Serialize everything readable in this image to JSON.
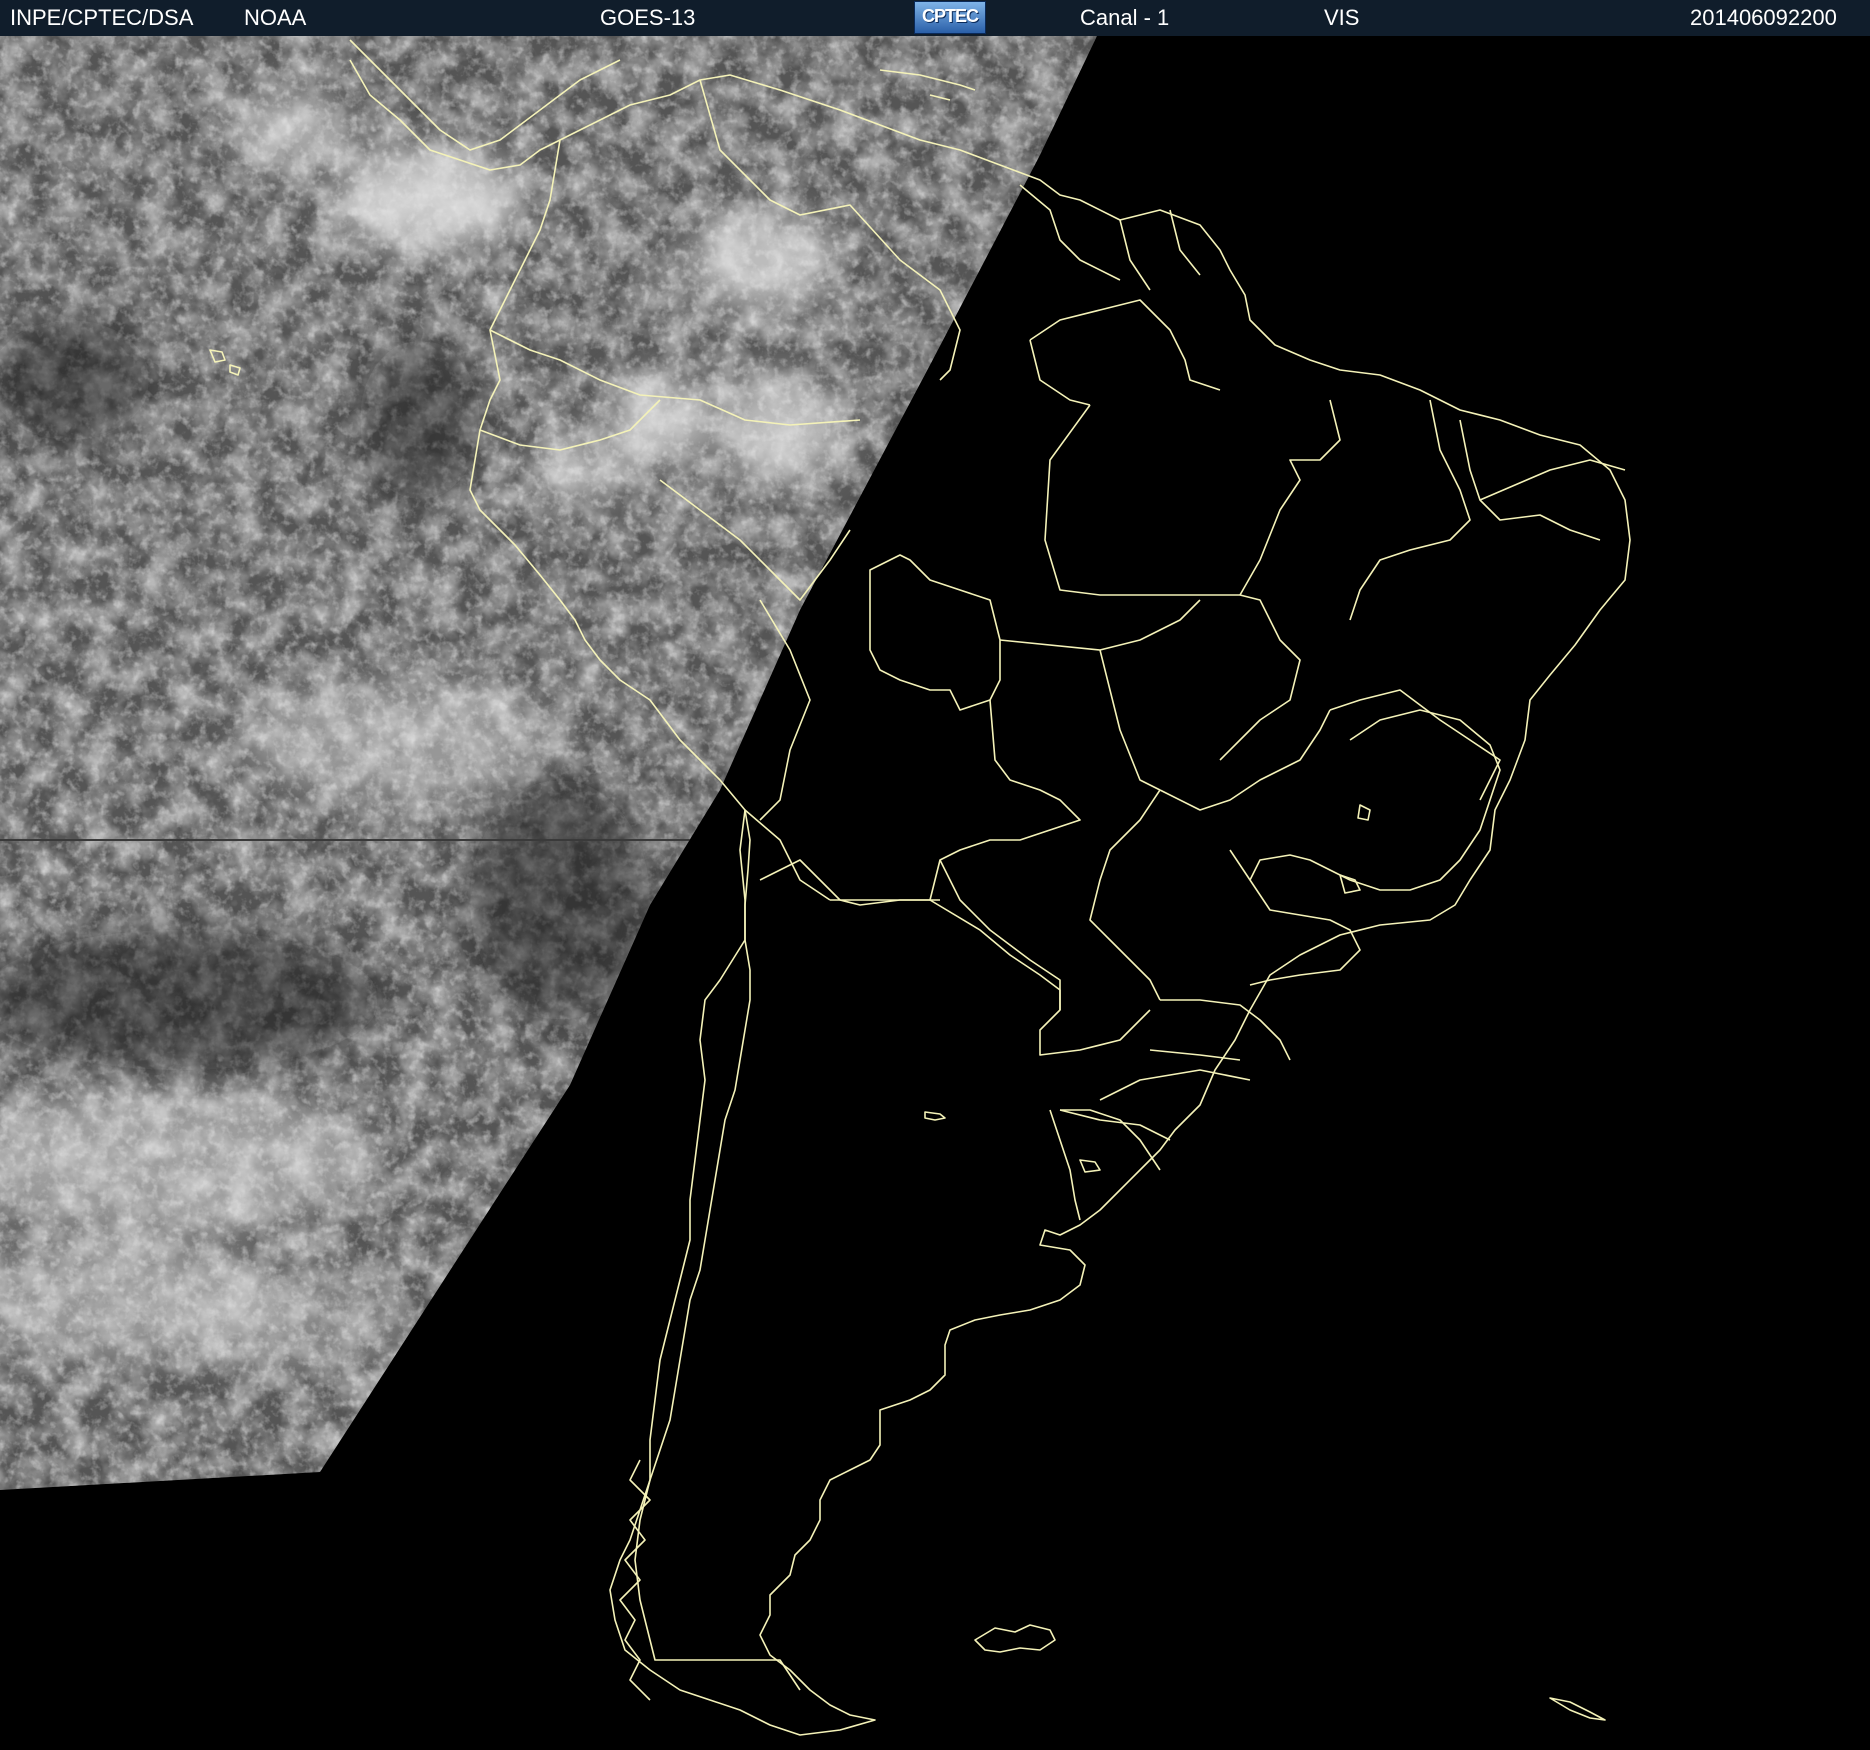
{
  "header": {
    "agency": "INPE/CPTEC/DSA",
    "provider": "NOAA",
    "satellite": "GOES-13",
    "logo_text": "CPTEC",
    "channel": "Canal - 1",
    "band": "VIS",
    "timestamp": "201406092200"
  },
  "colors": {
    "header_bg": "#101d2b",
    "header_text": "#ffffff",
    "boundary_line": "#f4f2b8",
    "night_side": "#000000",
    "cloud_day_side": "#5a5a5a"
  },
  "map": {
    "image_type": "visible satellite imagery",
    "region": "South America",
    "features": [
      "coastlines",
      "national borders",
      "Brazilian state borders",
      "day-night terminator"
    ]
  }
}
